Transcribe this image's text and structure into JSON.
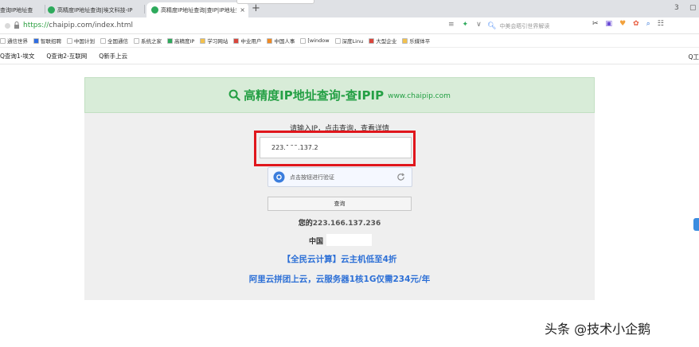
{
  "tabs": [
    {
      "label": "查询IP地址查",
      "active": false
    },
    {
      "label": "高精度IP地址查询|埃文科技-IP",
      "active": false
    },
    {
      "label": "高精度IP地址查询|查IP|IP地址查",
      "active": true,
      "close": "×"
    }
  ],
  "new_tab": "+",
  "window_controls": [
    "3",
    "▢"
  ],
  "address": {
    "protocol": "https://",
    "rest": "chaipip.com/index.html",
    "right_icons": [
      "≡",
      "✦",
      "∨"
    ],
    "search_placeholder": "中美会晤引世界解读",
    "search_icon": "search-icon"
  },
  "toolbar_icons": [
    "✂",
    "▣",
    "♥",
    "✿",
    "⌕",
    "☷"
  ],
  "bookmarks": [
    {
      "label": "通信世界",
      "color": "#ffffff"
    },
    {
      "label": "智联招聘",
      "color": "#2f6de3"
    },
    {
      "label": "中国计划",
      "color": "#ffffff"
    },
    {
      "label": "全国通信",
      "color": "#ffffff"
    },
    {
      "label": "系统之家",
      "color": "#ffffff"
    },
    {
      "label": "高精度IP",
      "color": "#2eaa5c"
    },
    {
      "label": "学习网站",
      "color": "#f2c14e"
    },
    {
      "label": "中业用户",
      "color": "#d9463c"
    },
    {
      "label": "中国人事",
      "color": "#f08a24"
    },
    {
      "label": "[window",
      "color": "#ffffff"
    },
    {
      "label": "深度Linu",
      "color": "#ffffff"
    },
    {
      "label": "大型企业",
      "color": "#d9463c"
    },
    {
      "label": "乐媒体平",
      "color": "#f2c14e"
    }
  ],
  "subbar": {
    "items": [
      "Q查询1-埃文",
      "Q查询2-互联网",
      "Q新手上云"
    ],
    "right": "Q工"
  },
  "page": {
    "banner_title": "高精度IP地址查询-查IPIP",
    "banner_domain": "www.chaipip.com",
    "hint": "请输入IP，点击查询，查看详情",
    "ip_value": "223.160.137.2",
    "captcha_text": "点击按钮进行验证",
    "query_button": "查询",
    "your_ip_label": "您的",
    "your_ip_value": "223.166.137.236",
    "location_label": "中国 .",
    "promo1": "【全民云计算】云主机低至4折",
    "promo2": "阿里云拼团上云，云服务器1核1G仅需234元/年"
  },
  "watermark": "头条 @技术小企鹅",
  "colors": {
    "accent_green": "#25a045",
    "banner_bg": "#d8ecd8",
    "red_highlight": "#e0161c",
    "promo_blue": "#2c6fd6"
  }
}
